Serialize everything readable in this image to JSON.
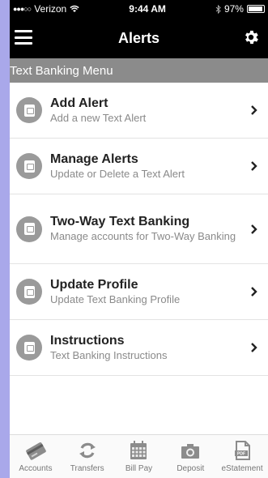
{
  "status_bar": {
    "signal": "●●●○○",
    "carrier": "Verizon",
    "time": "9:44 AM",
    "battery_percent": "97%",
    "battery_level": 0.97
  },
  "nav": {
    "title": "Alerts"
  },
  "section": {
    "title": "Text Banking Menu"
  },
  "menu_items": [
    {
      "title": "Add Alert",
      "subtitle": "Add a new Text Alert"
    },
    {
      "title": "Manage Alerts",
      "subtitle": "Update or Delete a Text Alert"
    },
    {
      "title": "Two-Way Text Banking",
      "subtitle": "Manage accounts for Two-Way Banking"
    },
    {
      "title": "Update Profile",
      "subtitle": "Update Text Banking Profile"
    },
    {
      "title": "Instructions",
      "subtitle": "Text Banking Instructions"
    }
  ],
  "tabs": [
    {
      "label": "Accounts",
      "icon": "credit-card-icon"
    },
    {
      "label": "Transfers",
      "icon": "refresh-arrows-icon"
    },
    {
      "label": "Bill Pay",
      "icon": "calendar-icon"
    },
    {
      "label": "Deposit",
      "icon": "camera-icon"
    },
    {
      "label": "eStatement",
      "icon": "pdf-document-icon"
    }
  ]
}
